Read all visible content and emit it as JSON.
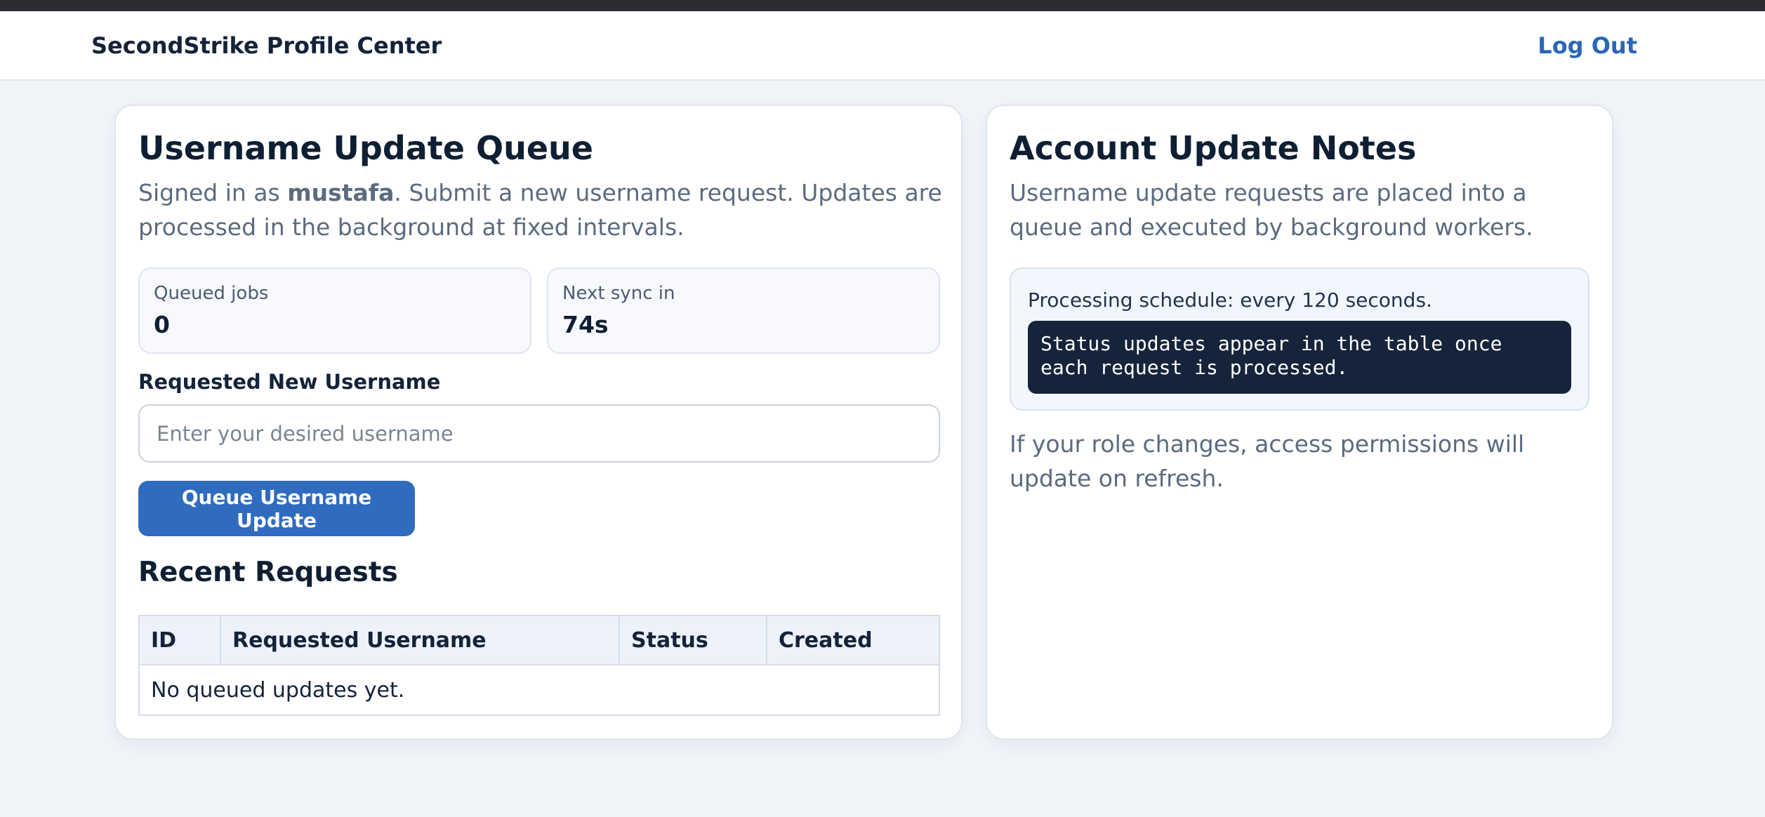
{
  "header": {
    "brand": "SecondStrike Profile Center",
    "logout_label": "Log Out"
  },
  "queue_card": {
    "title": "Username Update Queue",
    "signed_in_prefix": "Signed in as ",
    "username": "mustafa",
    "signed_in_suffix": ". Submit a new username request. Updates are processed in the background at fixed intervals.",
    "stats": [
      {
        "label": "Queued jobs",
        "value": "0"
      },
      {
        "label": "Next sync in",
        "value": "74s"
      }
    ],
    "field_label": "Requested New Username",
    "input_value": "",
    "input_placeholder": "Enter your desired username",
    "submit_label": "Queue Username Update",
    "recent_title": "Recent Requests",
    "table": {
      "columns": [
        "ID",
        "Requested Username",
        "Status",
        "Created"
      ],
      "empty_message": "No queued updates yet."
    }
  },
  "notes_card": {
    "title": "Account Update Notes",
    "intro": "Username update requests are placed into a queue and executed by background workers.",
    "schedule": "Processing schedule: every 120 seconds.",
    "code_note": "Status updates appear in the table once\neach request is processed.",
    "footer": "If your role changes, access permissions will update on refresh."
  },
  "colors": {
    "accent": "#2f6bbf",
    "link": "#2a67b8",
    "page_bg": "#f1f4f9",
    "code_bg": "#16243b"
  }
}
